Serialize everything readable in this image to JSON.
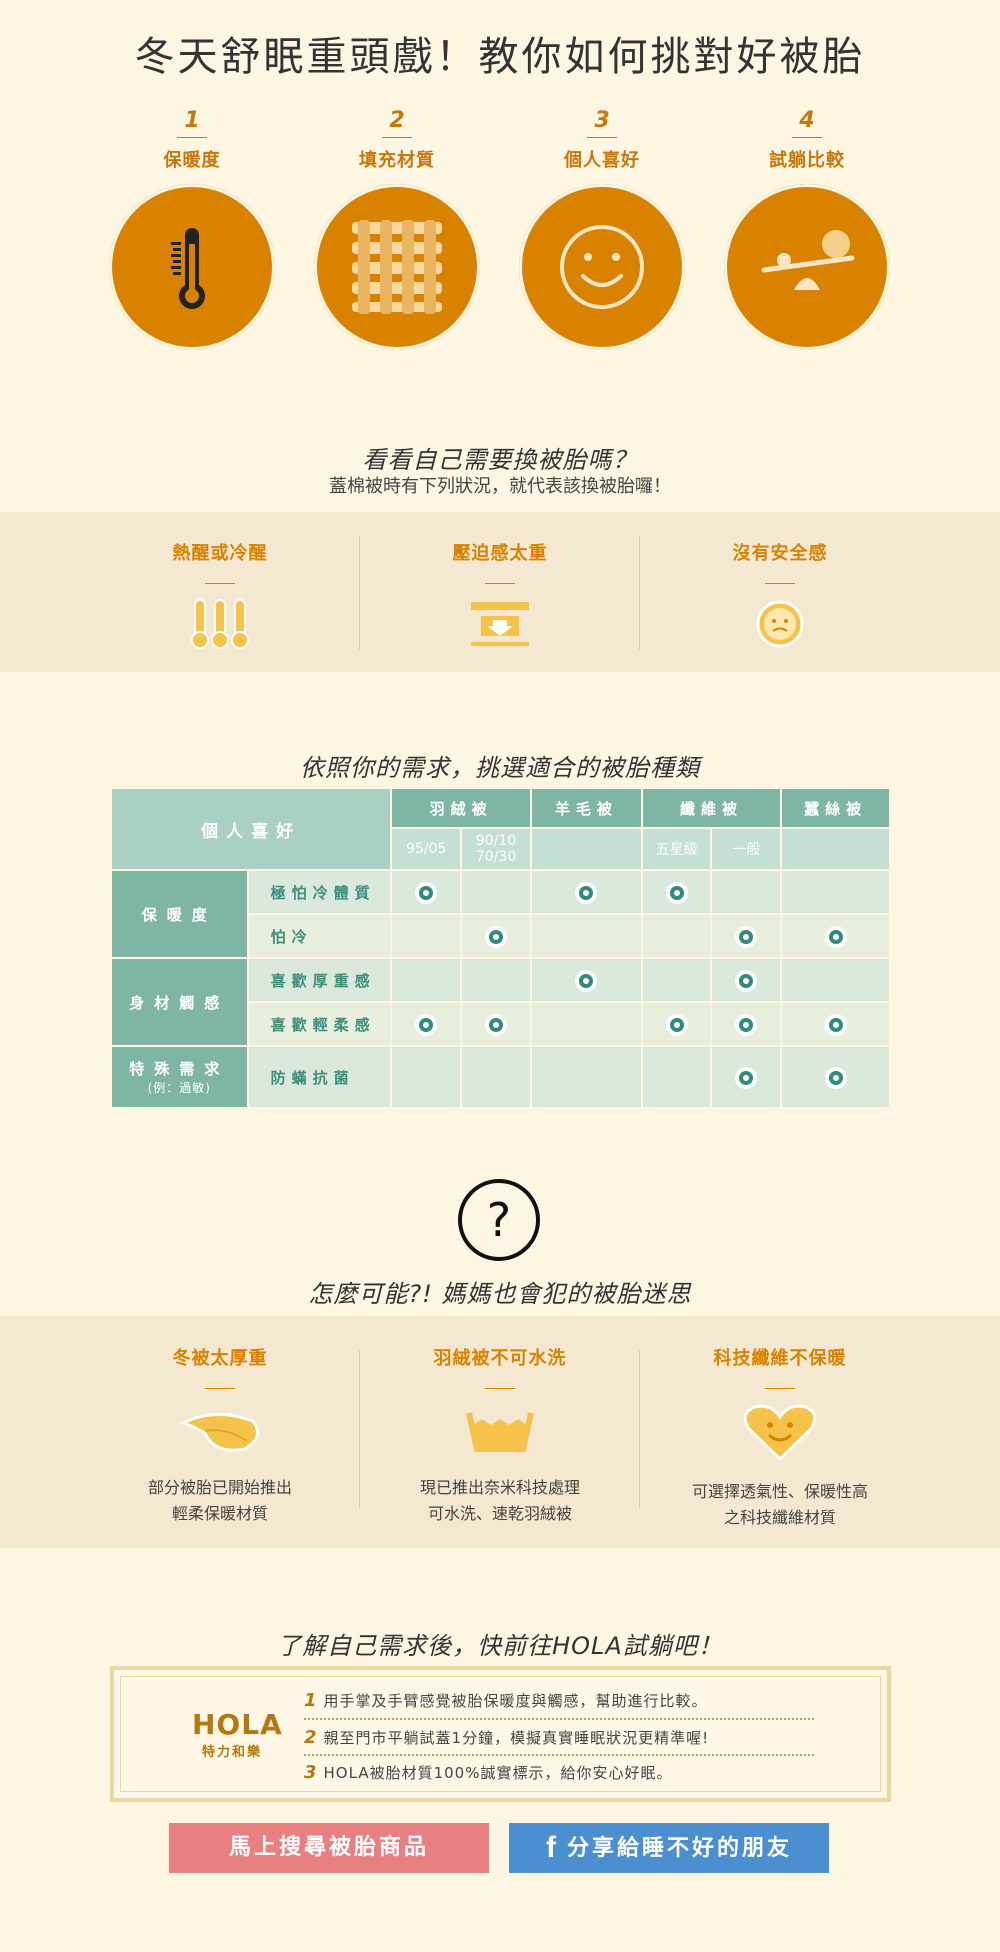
{
  "title": "冬天舒眠重頭戲！教你如何挑對好被胎",
  "steps": [
    {
      "num": "1",
      "label": "保暖度",
      "icon": "thermometer-icon"
    },
    {
      "num": "2",
      "label": "填充材質",
      "icon": "weave-icon"
    },
    {
      "num": "3",
      "label": "個人喜好",
      "icon": "smile-icon"
    },
    {
      "num": "4",
      "label": "試躺比較",
      "icon": "seesaw-icon"
    }
  ],
  "check": {
    "title": "看看自己需要換被胎嗎？",
    "subtitle": "蓋棉被時有下列狀況，就代表該換被胎囉！",
    "items": [
      {
        "label": "熱醒或冷醒",
        "icon": "thermometers-icon"
      },
      {
        "label": "壓迫感太重",
        "icon": "press-down-icon"
      },
      {
        "label": "沒有安全感",
        "icon": "worried-face-icon"
      }
    ]
  },
  "matrix": {
    "title": "依照你的需求，挑選適合的被胎種類",
    "corner": "個人喜好",
    "groups": [
      "羽絨被",
      "羊毛被",
      "纖維被",
      "蠶絲被"
    ],
    "subs": [
      "95/05",
      "90/10\n70/30",
      "",
      "五星級",
      "一般",
      ""
    ],
    "categories": [
      {
        "name": "保暖度",
        "rows": [
          {
            "label": "極怕冷體質",
            "marks": [
              1,
              0,
              1,
              1,
              0,
              0
            ]
          },
          {
            "label": "怕冷",
            "marks": [
              0,
              1,
              0,
              0,
              1,
              1
            ]
          }
        ]
      },
      {
        "name": "身材觸感",
        "rows": [
          {
            "label": "喜歡厚重感",
            "marks": [
              0,
              0,
              1,
              0,
              1,
              0
            ]
          },
          {
            "label": "喜歡輕柔感",
            "marks": [
              1,
              1,
              0,
              1,
              1,
              1
            ]
          }
        ]
      },
      {
        "name": "特殊需求",
        "note": "(例：過敏)",
        "rows": [
          {
            "label": "防蟎抗菌",
            "marks": [
              0,
              0,
              0,
              0,
              1,
              1
            ]
          }
        ]
      }
    ]
  },
  "myth": {
    "title": "怎麼可能?! 媽媽也會犯的被胎迷思",
    "items": [
      {
        "label": "冬被太厚重",
        "desc1": "部分被胎已開始推出",
        "desc2": "輕柔保暖材質",
        "icon": "feather-icon"
      },
      {
        "label": "羽絨被不可水洗",
        "desc1": "現已推出奈米科技處理",
        "desc2": "可水洗、速乾羽絨被",
        "icon": "wash-icon"
      },
      {
        "label": "科技纖維不保暖",
        "desc1": "可選擇透氣性、保暖性高",
        "desc2": "之科技纖維材質",
        "icon": "heart-smile-icon"
      }
    ]
  },
  "hola": {
    "title": "了解自己需求後，快前往HOLA試躺吧！",
    "logo_text": "HOLA",
    "logo_sub": "特力和樂",
    "tips": [
      {
        "n": "1",
        "text": "用手掌及手臂感覺被胎保暖度與觸感，幫助進行比較。"
      },
      {
        "n": "2",
        "text": "親至門市平躺試蓋1分鐘，模擬真實睡眠狀況更精準喔!"
      },
      {
        "n": "3",
        "text": "HOLA被胎材質100%誠實標示，給你安心好眠。"
      }
    ]
  },
  "buttons": {
    "search": "馬上搜尋被胎商品",
    "share": "分享給睡不好的朋友"
  },
  "colors": {
    "orange": "#d98200",
    "teal": "#7fb5a5",
    "pink": "#e87f80",
    "blue": "#4c8fd0"
  }
}
